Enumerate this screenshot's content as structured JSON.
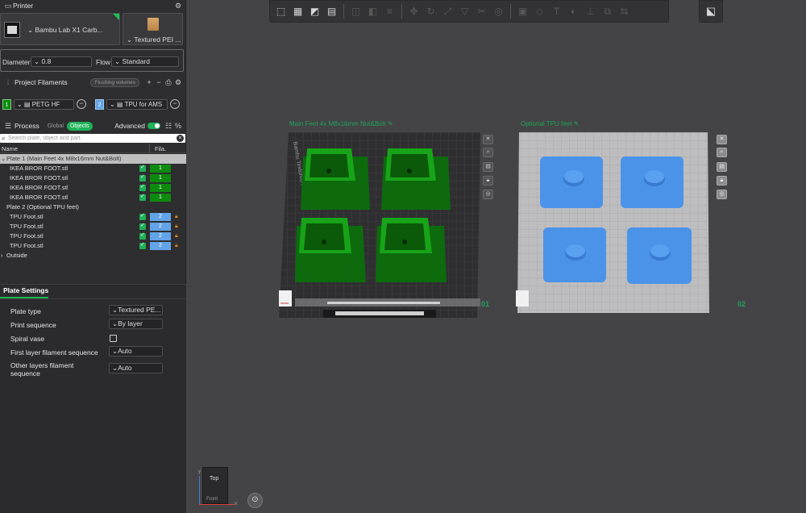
{
  "printer": {
    "section_title": "Printer",
    "name": "Bambu Lab X1 Carb...",
    "plate_type": "Textured PEI ...",
    "diameter_label": "Diameter",
    "diameter_value": "0.8",
    "flow_label": "Flow",
    "flow_value": "Standard"
  },
  "filaments": {
    "section_title": "Project Filaments",
    "flushing_label": "Flushing volumes",
    "items": [
      {
        "index": "1",
        "name": "PETG HF",
        "color": "#0d8a0d"
      },
      {
        "index": "2",
        "name": "TPU for AMS",
        "color": "#63a4e8"
      }
    ]
  },
  "process": {
    "section_title": "Process",
    "global_label": "Global",
    "objects_label": "Objects",
    "advanced_label": "Advanced",
    "search_placeholder": "Search plate, object and part.",
    "col_name": "Name",
    "col_fila": "Fila."
  },
  "tree": {
    "plate1": "Plate 1 (Main  Feet 4x M8x16mm Nut&Bolt)",
    "plate1_items": [
      {
        "name": "IKEA BROR FOOT.stl",
        "fila": "1"
      },
      {
        "name": "IKEA BROR FOOT.stl",
        "fila": "1"
      },
      {
        "name": "IKEA BROR FOOT.stl",
        "fila": "1"
      },
      {
        "name": "IKEA BROR FOOT.stl",
        "fila": "1"
      }
    ],
    "plate2": "Plate 2 (Optional TPU feet)",
    "plate2_items": [
      {
        "name": "TPU Foot.stl",
        "fila": "2"
      },
      {
        "name": "TPU Foot.stl",
        "fila": "2"
      },
      {
        "name": "TPU Foot.stl",
        "fila": "2"
      },
      {
        "name": "TPU Foot.stl",
        "fila": "2"
      }
    ],
    "outside": "Outside"
  },
  "plate_settings": {
    "title": "Plate Settings",
    "plate_type_label": "Plate type",
    "plate_type_value": "Textured PE...",
    "print_sequence_label": "Print sequence",
    "print_sequence_value": "By layer",
    "spiral_vase_label": "Spiral vase",
    "spiral_vase_checked": false,
    "first_layer_label": "First layer filament sequence",
    "first_layer_value": "Auto",
    "other_layers_label": "Other layers filament sequence",
    "other_layers_value": "Auto"
  },
  "viewport": {
    "plate1_title": "Main  Feet 4x M8x16mm Nut&Bolt",
    "plate1_number": "01",
    "plate1_bed_label": "Bambu Textured PEI Plate",
    "plate2_title": "Optional TPU feet",
    "plate2_number": "02",
    "nav_top": "Top",
    "nav_front": "Front",
    "axis_x": "x",
    "axis_y": "y"
  },
  "colors": {
    "accent": "#1fb157",
    "petg": "#0d8a0d",
    "tpu": "#63a4e8",
    "plate_title": "#1fa35a"
  }
}
